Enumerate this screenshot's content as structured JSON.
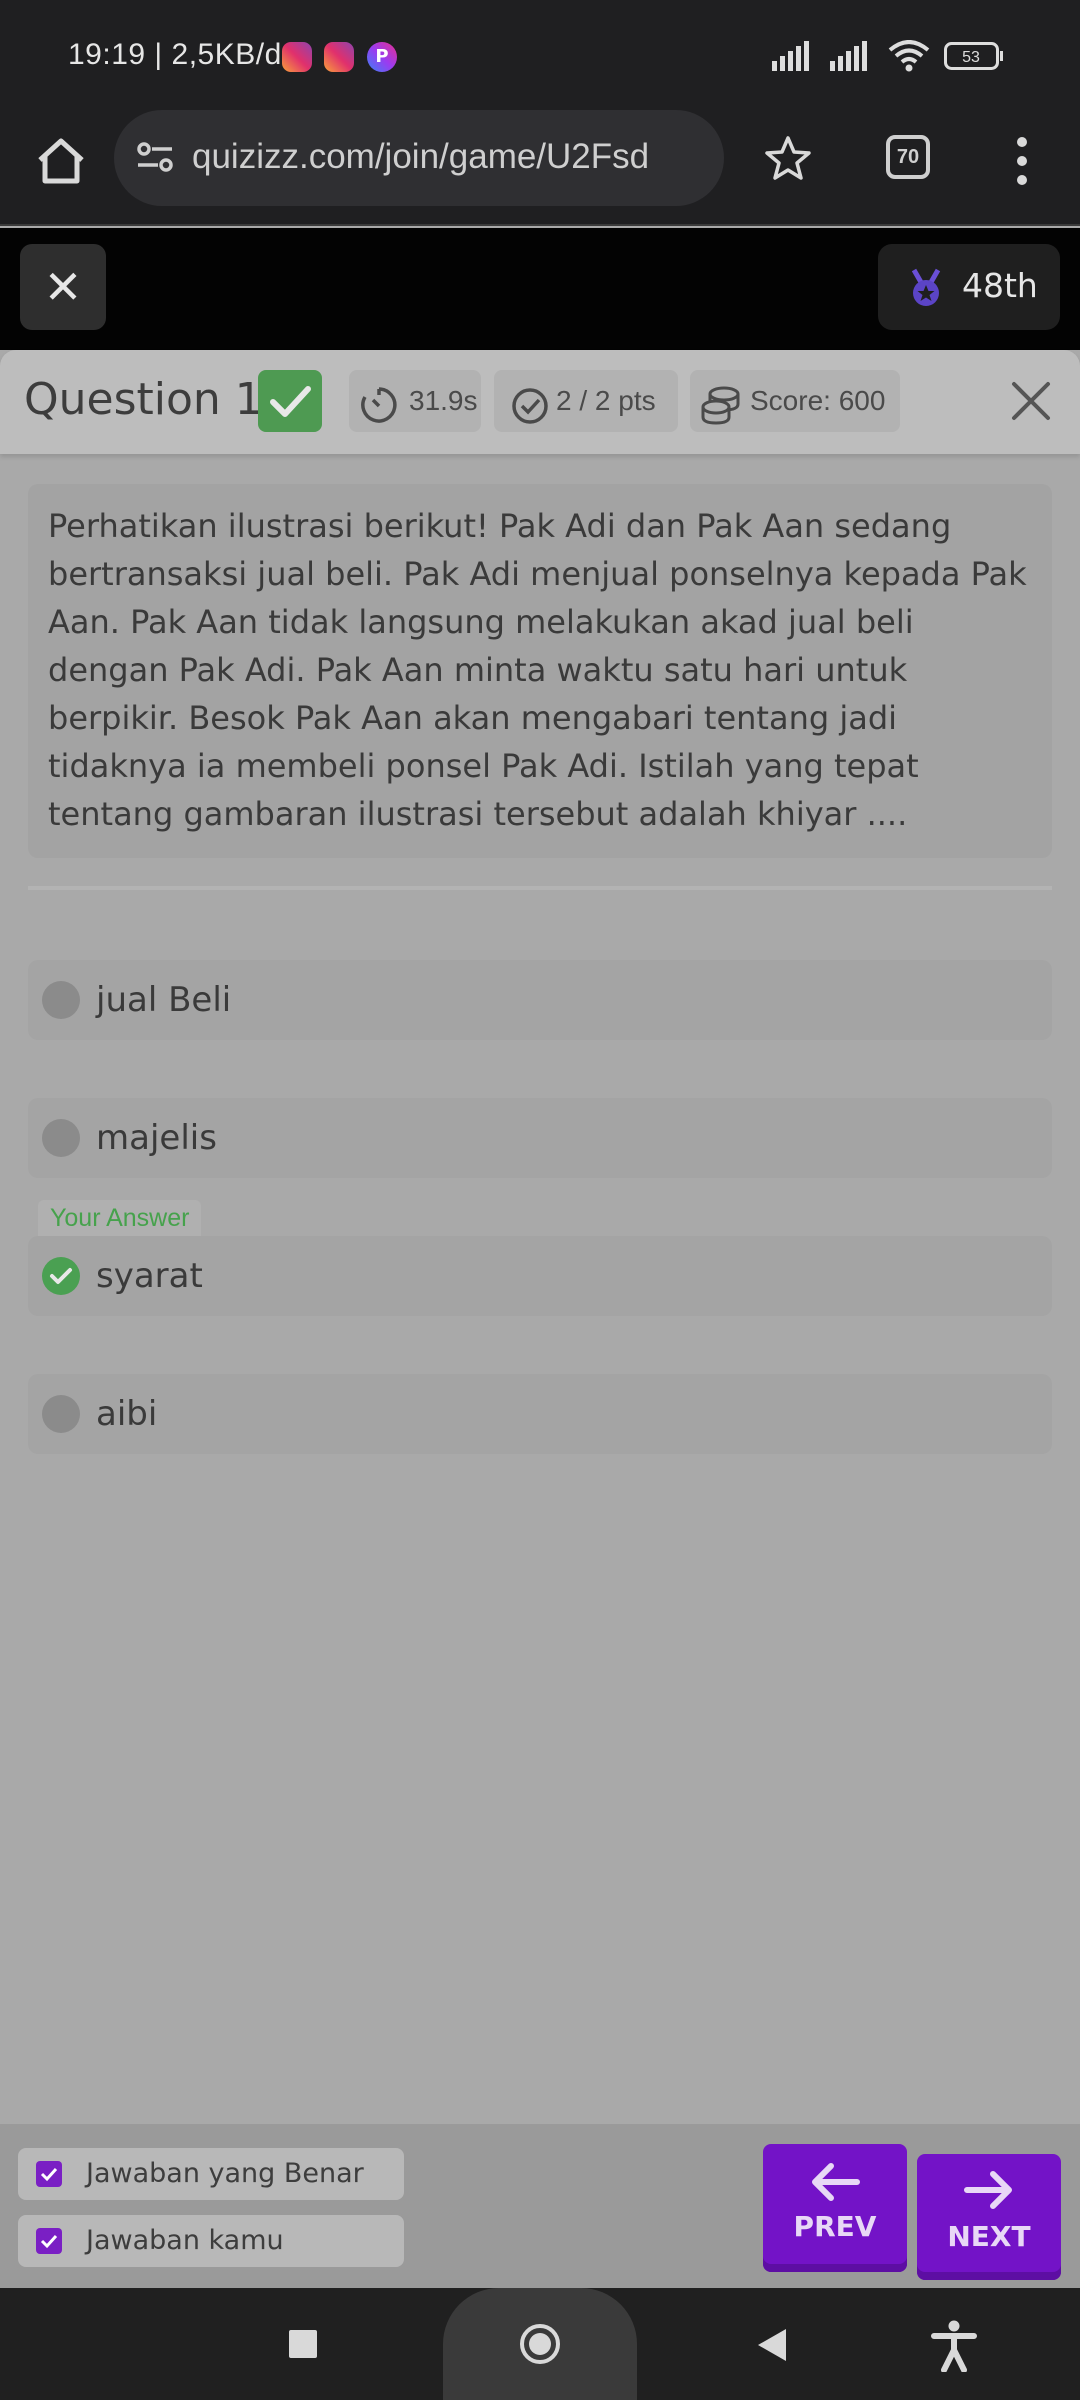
{
  "status_bar": {
    "time": "19:19 | 2,5KB/d",
    "battery": "53"
  },
  "browser": {
    "url": "quizizz.com/join/game/U2Fsd",
    "tab_count": "70"
  },
  "game_header": {
    "close_label": "✕",
    "rank": "48th"
  },
  "question_header": {
    "title": "Question 1",
    "time": "31.9s",
    "points": "2 / 2 pts",
    "score": "Score: 600"
  },
  "question": {
    "text": "Perhatikan ilustrasi berikut! Pak Adi dan Pak Aan sedang bertransaksi jual beli. Pak Adi menjual ponselnya kepada Pak Aan. Pak Aan tidak langsung melakukan akad jual beli dengan Pak Adi. Pak Aan minta waktu satu hari untuk berpikir. Besok Pak Aan akan mengabari tentang jadi tidaknya ia membeli ponsel Pak Adi. Istilah yang tepat tentang gambaran ilustrasi tersebut adalah khiyar ...."
  },
  "options": [
    {
      "label": "jual Beli",
      "selected": false
    },
    {
      "label": "majelis",
      "selected": false
    },
    {
      "label": "syarat",
      "selected": true
    },
    {
      "label": "aibi",
      "selected": false
    }
  ],
  "your_answer_label": "Your Answer",
  "legend": {
    "correct_answer": "Jawaban yang Benar",
    "your_answer": "Jawaban kamu"
  },
  "nav": {
    "prev": "PREV",
    "next": "NEXT"
  },
  "colors": {
    "accent_purple": "#7313c7",
    "correct_green": "#4e9a52"
  }
}
